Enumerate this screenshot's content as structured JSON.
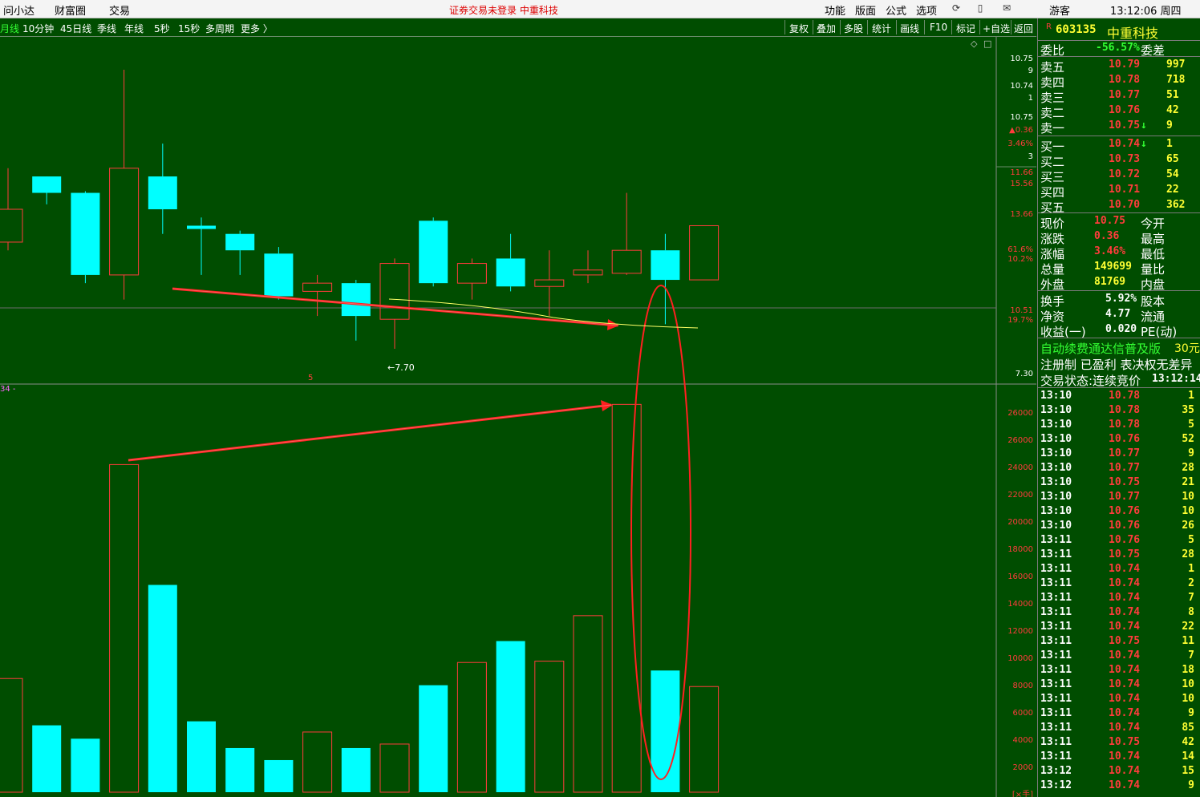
{
  "topbar": {
    "menu": [
      "问小达",
      "财富圈",
      "交易"
    ],
    "center": "证券交易未登录   中重科技",
    "right_menu": [
      "功能",
      "版面",
      "公式",
      "选项"
    ],
    "guest": "游客",
    "clock": "13:12:06 周四"
  },
  "toolbar": {
    "periods": [
      "月线",
      "10分钟",
      "45日线",
      "季线",
      "年线",
      "5秒",
      "15秒",
      "多周期",
      "更多 〉"
    ],
    "tools": [
      "复权",
      "叠加",
      "多股",
      "统计",
      "画线",
      "F10",
      "标记",
      "+自选",
      "返回"
    ]
  },
  "chart": {
    "price_label": "←7.70",
    "vol_label": "34 -",
    "marker": "5",
    "price_ticks": [
      "10.75",
      "9",
      "10.74",
      "1",
      "10.75",
      "▲0.36",
      "3.46%",
      "3",
      "11.66",
      "15.56",
      "13.66",
      "61.6%",
      "10.2%",
      "10.51",
      "19.7%",
      "7.30"
    ],
    "vol_ticks": [
      "26000",
      "26000",
      "24000",
      "22000",
      "20000",
      "18000",
      "16000",
      "14000",
      "12000",
      "10000",
      "8000",
      "6000",
      "4000",
      "2000",
      "[×手]"
    ]
  },
  "chart_data": {
    "type": "candlestick",
    "title": "",
    "series": [
      {
        "name": "price",
        "values": [
          {
            "o": 10.85,
            "h": 11.1,
            "l": 10.6,
            "c": 10.65,
            "up": true
          },
          {
            "o": 10.95,
            "h": 10.96,
            "l": 10.88,
            "c": 11.05,
            "up": false
          },
          {
            "o": 10.95,
            "h": 10.96,
            "l": 10.4,
            "c": 10.45,
            "up": false
          },
          {
            "o": 10.45,
            "h": 11.7,
            "l": 10.3,
            "c": 11.1,
            "up": true
          },
          {
            "o": 11.05,
            "h": 11.25,
            "l": 10.7,
            "c": 10.85,
            "up": false
          },
          {
            "o": 10.75,
            "h": 10.8,
            "l": 10.45,
            "c": 10.73,
            "up": false
          },
          {
            "o": 10.7,
            "h": 10.72,
            "l": 10.45,
            "c": 10.6,
            "up": false
          },
          {
            "o": 10.58,
            "h": 10.62,
            "l": 10.3,
            "c": 10.32,
            "up": false
          },
          {
            "o": 10.35,
            "h": 10.45,
            "l": 10.2,
            "c": 10.4,
            "up": true
          },
          {
            "o": 10.4,
            "h": 10.42,
            "l": 10.05,
            "c": 10.2,
            "up": false
          },
          {
            "o": 10.18,
            "h": 10.55,
            "l": 10.0,
            "c": 10.52,
            "up": true
          },
          {
            "o": 10.78,
            "h": 10.8,
            "l": 10.38,
            "c": 10.4,
            "up": false
          },
          {
            "o": 10.4,
            "h": 10.55,
            "l": 10.3,
            "c": 10.52,
            "up": true
          },
          {
            "o": 10.55,
            "h": 10.7,
            "l": 10.35,
            "c": 10.38,
            "up": false
          },
          {
            "o": 10.38,
            "h": 10.6,
            "l": 10.2,
            "c": 10.42,
            "up": true
          },
          {
            "o": 10.45,
            "h": 10.6,
            "l": 10.4,
            "c": 10.48,
            "up": true
          },
          {
            "o": 10.46,
            "h": 10.95,
            "l": 10.45,
            "c": 10.6,
            "up": true
          },
          {
            "o": 10.6,
            "h": 10.7,
            "l": 10.15,
            "c": 10.42,
            "up": false
          },
          {
            "o": 10.42,
            "h": 10.75,
            "l": 10.42,
            "c": 10.75,
            "up": true
          }
        ]
      },
      {
        "name": "volume",
        "values": [
          8500,
          5000,
          4000,
          24500,
          15500,
          5300,
          3300,
          2400,
          4500,
          3300,
          3600,
          8000,
          9700,
          11300,
          9800,
          13200,
          29000,
          9100,
          7900
        ]
      }
    ]
  },
  "right": {
    "code": "603135",
    "name": "中重科技",
    "weibi_label": "委比",
    "weibi": "-56.57%",
    "weicha_label": "委差",
    "asks": [
      {
        "label": "卖五",
        "price": "10.79",
        "vol": "997",
        "flag": ""
      },
      {
        "label": "卖四",
        "price": "10.78",
        "vol": "718",
        "flag": ""
      },
      {
        "label": "卖三",
        "price": "10.77",
        "vol": "51",
        "flag": ""
      },
      {
        "label": "卖二",
        "price": "10.76",
        "vol": "42",
        "flag": ""
      },
      {
        "label": "卖一",
        "price": "10.75",
        "vol": "9",
        "flag": "↓"
      }
    ],
    "bids": [
      {
        "label": "买一",
        "price": "10.74",
        "vol": "1",
        "flag": "↓"
      },
      {
        "label": "买二",
        "price": "10.73",
        "vol": "65",
        "flag": ""
      },
      {
        "label": "买三",
        "price": "10.72",
        "vol": "54",
        "flag": ""
      },
      {
        "label": "买四",
        "price": "10.71",
        "vol": "22",
        "flag": ""
      },
      {
        "label": "买五",
        "price": "10.70",
        "vol": "362",
        "flag": ""
      }
    ],
    "stats": [
      {
        "l1": "现价",
        "v1": "10.75",
        "l2": "今开",
        "c": "red"
      },
      {
        "l1": "涨跌",
        "v1": "0.36",
        "l2": "最高",
        "c": "red"
      },
      {
        "l1": "涨幅",
        "v1": "3.46%",
        "l2": "最低",
        "c": "red"
      },
      {
        "l1": "总量",
        "v1": "149699",
        "l2": "量比",
        "c": "yellow"
      },
      {
        "l1": "外盘",
        "v1": "81769",
        "l2": "内盘",
        "c": "yellow"
      }
    ],
    "stats2": [
      {
        "l1": "换手",
        "v1": "5.92%",
        "l2": "股本"
      },
      {
        "l1": "净资",
        "v1": "4.77",
        "l2": "流通"
      },
      {
        "l1": "收益(一)",
        "v1": "0.020",
        "l2": "PE(动)"
      }
    ],
    "promo": "自动续费通达信普及版",
    "promo_price": "30元",
    "notice": "注册制 已盈利 表决权无差异",
    "status_label": "交易状态:连续竞价",
    "status_time": "13:12:14",
    "ticks": [
      {
        "t": "13:10",
        "p": "10.78",
        "v": "1",
        "c": "red"
      },
      {
        "t": "13:10",
        "p": "10.78",
        "v": "35",
        "c": "red"
      },
      {
        "t": "13:10",
        "p": "10.78",
        "v": "5",
        "c": "red"
      },
      {
        "t": "13:10",
        "p": "10.76",
        "v": "52",
        "c": "red"
      },
      {
        "t": "13:10",
        "p": "10.77",
        "v": "9",
        "c": "red"
      },
      {
        "t": "13:10",
        "p": "10.77",
        "v": "28",
        "c": "red"
      },
      {
        "t": "13:10",
        "p": "10.75",
        "v": "21",
        "c": "red"
      },
      {
        "t": "13:10",
        "p": "10.77",
        "v": "10",
        "c": "red"
      },
      {
        "t": "13:10",
        "p": "10.76",
        "v": "10",
        "c": "red"
      },
      {
        "t": "13:10",
        "p": "10.76",
        "v": "26",
        "c": "red"
      },
      {
        "t": "13:11",
        "p": "10.76",
        "v": "5",
        "c": "red"
      },
      {
        "t": "13:11",
        "p": "10.75",
        "v": "28",
        "c": "red"
      },
      {
        "t": "13:11",
        "p": "10.74",
        "v": "1",
        "c": "red"
      },
      {
        "t": "13:11",
        "p": "10.74",
        "v": "2",
        "c": "red"
      },
      {
        "t": "13:11",
        "p": "10.74",
        "v": "7",
        "c": "red"
      },
      {
        "t": "13:11",
        "p": "10.74",
        "v": "8",
        "c": "red"
      },
      {
        "t": "13:11",
        "p": "10.74",
        "v": "22",
        "c": "red"
      },
      {
        "t": "13:11",
        "p": "10.75",
        "v": "11",
        "c": "red"
      },
      {
        "t": "13:11",
        "p": "10.74",
        "v": "7",
        "c": "red"
      },
      {
        "t": "13:11",
        "p": "10.74",
        "v": "18",
        "c": "red"
      },
      {
        "t": "13:11",
        "p": "10.74",
        "v": "10",
        "c": "red"
      },
      {
        "t": "13:11",
        "p": "10.74",
        "v": "10",
        "c": "red"
      },
      {
        "t": "13:11",
        "p": "10.74",
        "v": "9",
        "c": "red"
      },
      {
        "t": "13:11",
        "p": "10.74",
        "v": "85",
        "c": "red"
      },
      {
        "t": "13:11",
        "p": "10.75",
        "v": "42",
        "c": "red"
      },
      {
        "t": "13:11",
        "p": "10.74",
        "v": "14",
        "c": "red"
      },
      {
        "t": "13:12",
        "p": "10.74",
        "v": "15",
        "c": "red"
      },
      {
        "t": "13:12",
        "p": "10.74",
        "v": "9",
        "c": "red"
      }
    ]
  },
  "colors": {
    "bg": "#004d00",
    "up": "#ff3c3c",
    "down": "#00ffff",
    "annot": "#ff2020"
  }
}
